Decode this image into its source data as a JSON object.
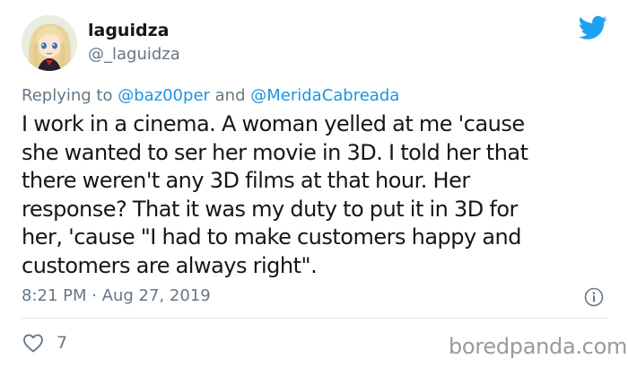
{
  "user": {
    "display_name": "laguidza",
    "handle": "@_laguidza"
  },
  "reply": {
    "prefix": "Replying to ",
    "mention_1": "@baz00per",
    "joiner": " and ",
    "mention_2": "@MeridaCabreada"
  },
  "tweet": {
    "text": "I work in a cinema. A woman yelled at me 'cause\nshe wanted to ser her movie in 3D. I told her that\nthere weren't any 3D films at that hour. Her\nresponse? That it was my duty to put it in 3D for\nher, 'cause \"I had to make customers happy and\ncustomers are always right\".",
    "timestamp": "8:21 PM · Aug 27, 2019",
    "like_count": "7"
  },
  "watermark": "boredpanda.com",
  "icons": {
    "brand": "twitter-bird-icon",
    "info": "info-icon",
    "like": "heart-icon"
  },
  "colors": {
    "twitter_blue": "#1da1f2",
    "mention_blue": "#1b95e0",
    "secondary_text": "#657786",
    "primary_text": "#14171a",
    "divider": "#e1e8ed"
  }
}
